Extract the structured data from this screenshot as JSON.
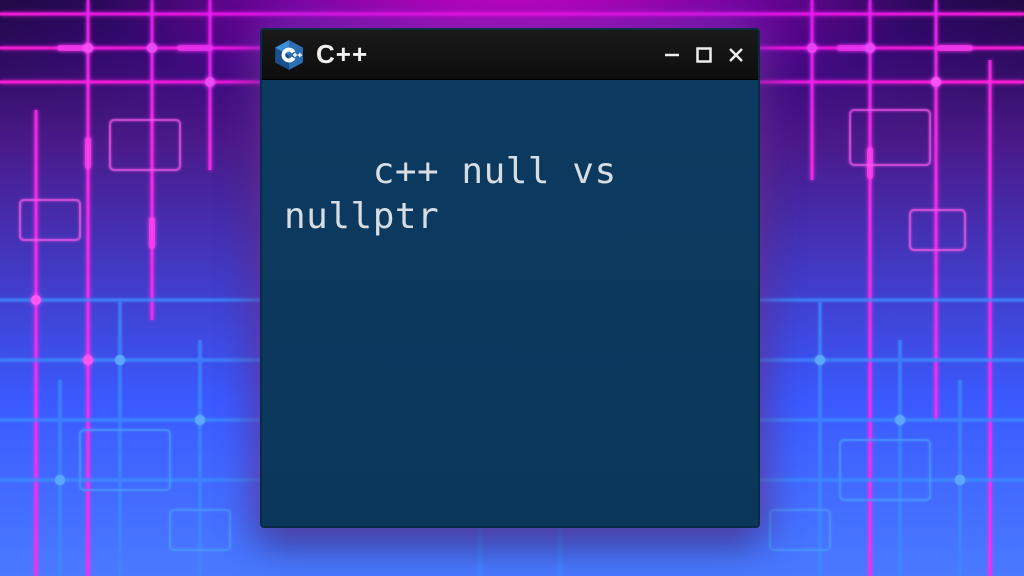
{
  "window": {
    "app_title": "C++",
    "icon_name": "cpp-icon"
  },
  "terminal": {
    "content": "c++ null vs nullptr"
  },
  "colors": {
    "accent_magenta": "#ff1ad8",
    "accent_blue": "#2a6aff",
    "terminal_bg": "#0b3a5f",
    "text": "#d8dde2"
  }
}
